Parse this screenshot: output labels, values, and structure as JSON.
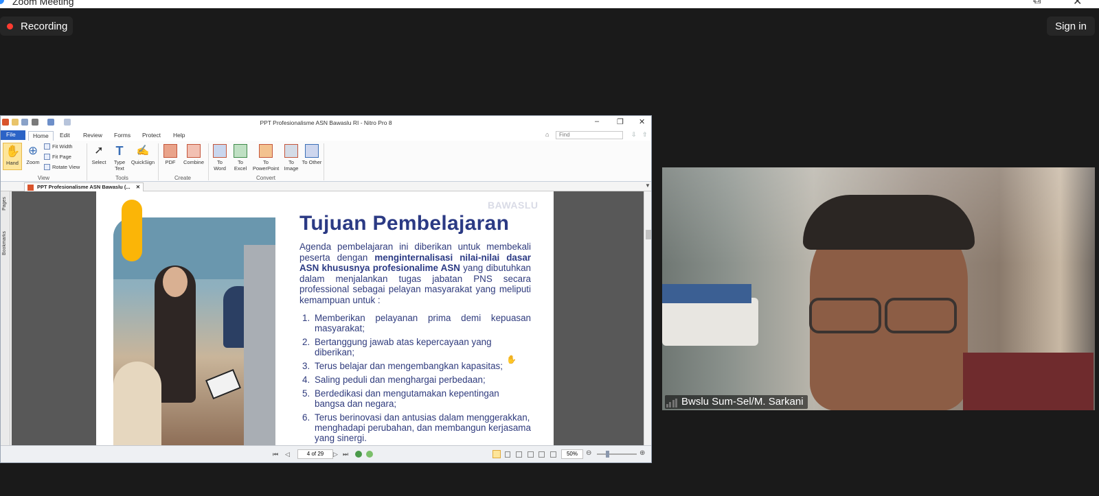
{
  "window": {
    "title": "Zoom Meeting"
  },
  "top_controls": {
    "recording_label": "Recording",
    "signin_label": "Sign in"
  },
  "nitro": {
    "title": "PPT Profesionalisme ASN Bawaslu RI - Nitro Pro 8",
    "tabs": [
      "File",
      "Home",
      "Edit",
      "Review",
      "Forms",
      "Protect",
      "Help"
    ],
    "find_placeholder": "Find",
    "ribbon": {
      "hand": "Hand",
      "zoom": "Zoom",
      "fit_width": "Fit Width",
      "fit_page": "Fit Page",
      "rotate_view": "Rotate View",
      "group_view": "View",
      "select": "Select",
      "type_text": "Type Text",
      "quicksign": "QuickSign",
      "group_tools": "Tools",
      "pdf": "PDF",
      "combine": "Combine",
      "group_create": "Create",
      "to_word": "To Word",
      "to_excel": "To Excel",
      "to_powerpoint": "To PowerPoint",
      "to_image": "To Image",
      "to_other": "To Other",
      "group_convert": "Convert"
    },
    "doc_tab": "PPT Profesionalisme ASN Bawaslu (...",
    "side_tabs": [
      "Pages",
      "Bookmarks"
    ],
    "status": {
      "page_indicator": "4 of 29",
      "zoom": "50%"
    }
  },
  "slide": {
    "watermark": "BAWASLU",
    "title": "Tujuan Pembelajaran",
    "intro_a": "Agenda pembelajaran ini diberikan untuk membekali peserta dengan ",
    "intro_b": "menginternalisasi nilai-nilai dasar ASN khususnya profesionalime ASN",
    "intro_c": " yang dibutuhkan dalam menjalankan tugas jabatan PNS secara professional sebagai pelayan masyarakat yang meliputi kemampuan untuk :",
    "items": [
      {
        "n": "1.",
        "text": "Memberikan pelayanan prima demi kepuasan masyarakat;"
      },
      {
        "n": "2.",
        "text": "Bertanggung jawab atas kepercayaan yang diberikan;"
      },
      {
        "n": "3.",
        "text": "Terus belajar dan mengembangkan kapasitas;"
      },
      {
        "n": "4.",
        "text": "Saling peduli dan menghargai perbedaan;"
      },
      {
        "n": "5.",
        "text": "Berdedikasi dan mengutamakan kepentingan bangsa dan negara;"
      },
      {
        "n": "6.",
        "text": "Terus berinovasi dan antusias dalam menggerakkan, menghadapi perubahan, dan membangun kerjasama yang sinergi."
      }
    ]
  },
  "participant": {
    "name": "Bwslu Sum-Sel/M. Sarkani"
  },
  "colors": {
    "accent": "#2b3a84",
    "recording": "#ff3b30",
    "slide_yellow": "#fbb507",
    "nitro_file_tab": "#2b63c6"
  }
}
